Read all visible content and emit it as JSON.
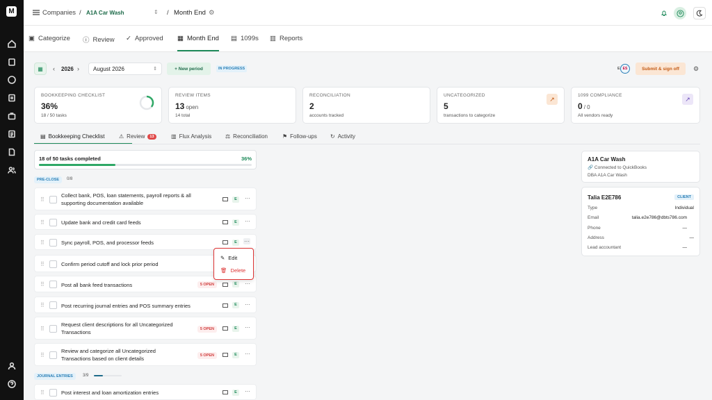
{
  "breadcrumb": {
    "companies": "Companies",
    "company": "A1A Car Wash",
    "separator": "/",
    "page": "Month End"
  },
  "nav": {
    "tabs": [
      {
        "label": "Categorize"
      },
      {
        "label": "Review"
      },
      {
        "label": "Approved"
      },
      {
        "label": "Month End"
      },
      {
        "label": "1099s"
      },
      {
        "label": "Reports"
      }
    ]
  },
  "controls": {
    "year": "2026",
    "month": "August 2026",
    "new_period": "+ New period",
    "status": "IN PROGRESS",
    "avatar_e": "E",
    "avatar_es": "ES",
    "submit": "Submit & sign off"
  },
  "cards": [
    {
      "title": "BOOKKEEPING CHECKLIST",
      "value": "36%",
      "unit": "",
      "sub": "18 / 50 tasks",
      "progress": 0.36
    },
    {
      "title": "REVIEW ITEMS",
      "value": "13",
      "unit": "open",
      "sub": "14 total"
    },
    {
      "title": "RECONCILIATION",
      "value": "2",
      "unit": "",
      "sub": "accounts tracked"
    },
    {
      "title": "UNCATEGORIZED",
      "value": "5",
      "unit": "",
      "sub": "transactions to categorize"
    },
    {
      "title": "1099 COMPLIANCE",
      "value": "0",
      "unit": "/ 0",
      "sub": "All vendors ready"
    }
  ],
  "subtabs": [
    {
      "label": "Bookkeeping Checklist"
    },
    {
      "label": "Review",
      "badge": "13"
    },
    {
      "label": "Flux Analysis"
    },
    {
      "label": "Reconciliation"
    },
    {
      "label": "Follow-ups"
    },
    {
      "label": "Activity"
    }
  ],
  "progress": {
    "label": "18 of 50 tasks completed",
    "pct": "36%",
    "fraction": 0.36
  },
  "sections": [
    {
      "label": "PRE-CLOSE",
      "count": "0/8"
    },
    {
      "label": "JOURNAL ENTRIES",
      "count": "3/9",
      "fraction": 0.33
    }
  ],
  "tasks": [
    {
      "line1": "Collect bank, POS, loan statements, payroll reports & all",
      "line2": "supporting documentation available",
      "open": ""
    },
    {
      "line1": "Update bank and credit card feeds",
      "line2": "",
      "open": ""
    },
    {
      "line1": "Sync payroll, POS, and processor feeds",
      "line2": "",
      "open": ""
    },
    {
      "line1": "Confirm period cutoff and lock prior period",
      "line2": "",
      "open": ""
    },
    {
      "line1": "Post all bank feed transactions",
      "line2": "",
      "open": "5 OPEN"
    },
    {
      "line1": "Post recurring journal entries and POS summary entries",
      "line2": "",
      "open": ""
    },
    {
      "line1": "Request client descriptions for all Uncategorized",
      "line2": "Transactions",
      "open": "5 OPEN"
    },
    {
      "line1": "Review and categorize all Uncategorized",
      "line2": "Transactions based on client details",
      "open": "5 OPEN"
    },
    {
      "line1": "Post interest and loan amortization entries",
      "line2": "",
      "open": ""
    }
  ],
  "task_e": "E",
  "popup": {
    "edit": "Edit",
    "delete": "Delete"
  },
  "company_panel": {
    "name": "A1A Car Wash",
    "connected": "Connected to QuickBooks",
    "dba": "DBA A1A Car Wash"
  },
  "client_panel": {
    "name": "Talia E2E786",
    "badge": "CLIENT",
    "rows": [
      {
        "k": "Type",
        "v": "Individual"
      },
      {
        "k": "Email",
        "v": "talia.e2e786@dbts786.com"
      },
      {
        "k": "Phone",
        "v": "—"
      },
      {
        "k": "Address",
        "v": "—"
      },
      {
        "k": "Lead accountant",
        "v": "—"
      }
    ]
  },
  "colors": {
    "accent": "#1e8a5a",
    "danger": "#d33",
    "info": "#2a7fb6"
  }
}
